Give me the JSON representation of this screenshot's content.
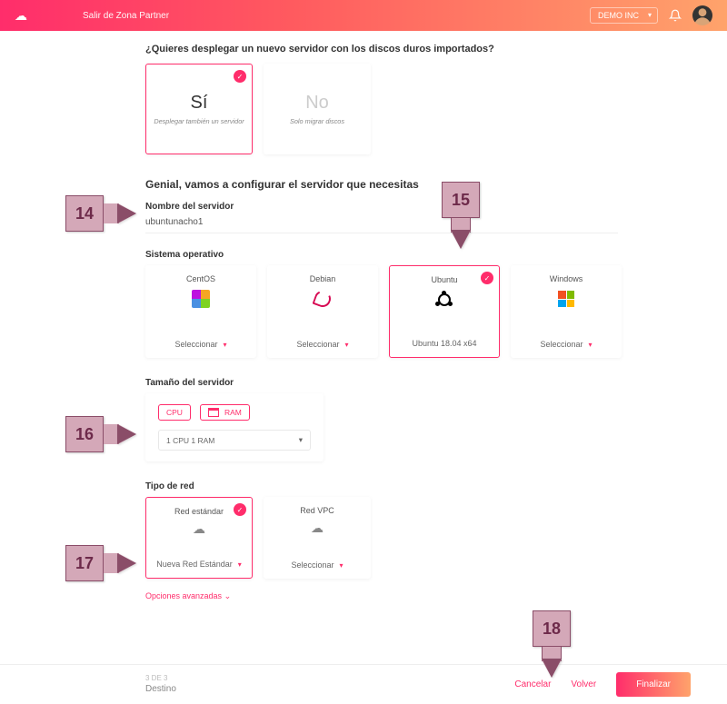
{
  "topbar": {
    "exit_link": "Salir de Zona Partner",
    "org_name": "DEMO INC"
  },
  "question": "¿Quieres desplegar un nuevo servidor con los discos duros importados?",
  "deploy_choice": {
    "yes": {
      "title": "Sí",
      "sub": "Desplegar también un servidor"
    },
    "no": {
      "title": "No",
      "sub": "Solo migrar discos"
    }
  },
  "config_heading": "Genial, vamos a configurar el servidor que necesitas",
  "server_name": {
    "label": "Nombre del servidor",
    "value": "ubuntunacho1"
  },
  "os": {
    "label": "Sistema operativo",
    "select_text": "Seleccionar",
    "options": [
      {
        "name": "CentOS",
        "selected_text": "Seleccionar"
      },
      {
        "name": "Debian",
        "selected_text": "Seleccionar"
      },
      {
        "name": "Ubuntu",
        "selected_text": "Ubuntu 18.04 x64",
        "selected": true
      },
      {
        "name": "Windows",
        "selected_text": "Seleccionar"
      }
    ]
  },
  "size": {
    "label": "Tamaño del servidor",
    "cpu_chip": "CPU",
    "ram_chip": "RAM",
    "value": "1 CPU        1 RAM"
  },
  "network": {
    "label": "Tipo de red",
    "options": [
      {
        "name": "Red estándar",
        "selected_text": "Nueva Red Estándar",
        "selected": true
      },
      {
        "name": "Red VPC",
        "selected_text": "Seleccionar"
      }
    ]
  },
  "advanced": "Opciones avanzadas",
  "footer": {
    "step": "3 DE 3",
    "dest": "Destino",
    "cancel": "Cancelar",
    "back": "Volver",
    "finish": "Finalizar"
  },
  "callouts": {
    "c14": "14",
    "c15": "15",
    "c16": "16",
    "c17": "17",
    "c18": "18"
  }
}
